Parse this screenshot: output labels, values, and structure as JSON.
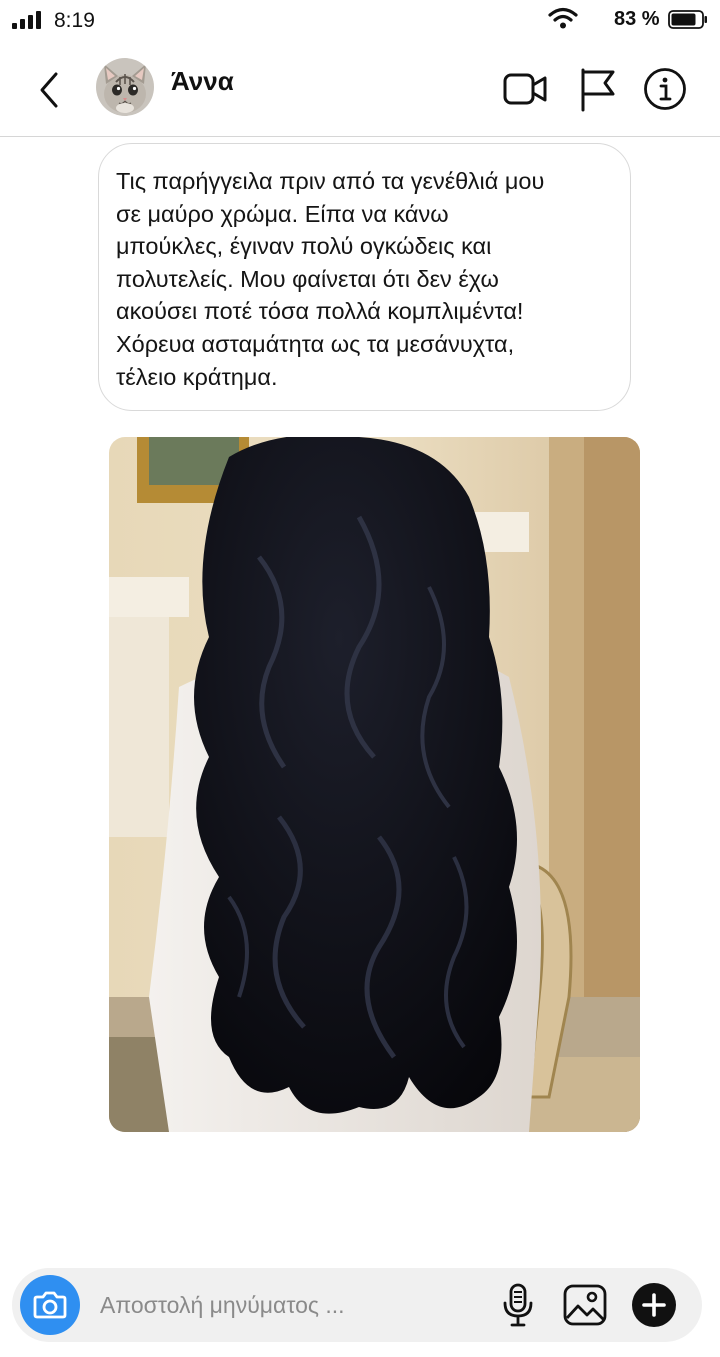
{
  "status_bar": {
    "time": "8:19",
    "battery_percent": "83 %",
    "icons": [
      "signal-icon",
      "wifi-icon",
      "battery-icon"
    ]
  },
  "header": {
    "contact_name": "Άννα",
    "icons": [
      "back-icon",
      "avatar-cat",
      "video-camera-icon",
      "flag-icon",
      "info-icon"
    ]
  },
  "message": {
    "lines": [
      "Τις παρήγγειλα πριν από τα γενέθλιά μου",
      "σε μαύρο χρώμα. Είπα να κάνω",
      "μπούκλες, έγιναν πολύ ογκώδεις και",
      "πολυτελείς. Μου φαίνεται ότι δεν έχω",
      "ακούσει ποτέ τόσα πολλά κομπλιμέντα!",
      "Χόρευα ασταμάτητα ως τα μεσάνυχτα,",
      "τέλειο κράτημα."
    ]
  },
  "composer": {
    "placeholder": "Αποστολή μηνύματος ...",
    "value": "",
    "icons": [
      "camera-icon",
      "microphone-icon",
      "image-icon",
      "plus-icon"
    ]
  },
  "colors": {
    "accent": "#2f8ff1",
    "composer_bg": "#f0f0f0",
    "divider": "#d6d6d6",
    "bubble_border": "#d9d9d9"
  }
}
